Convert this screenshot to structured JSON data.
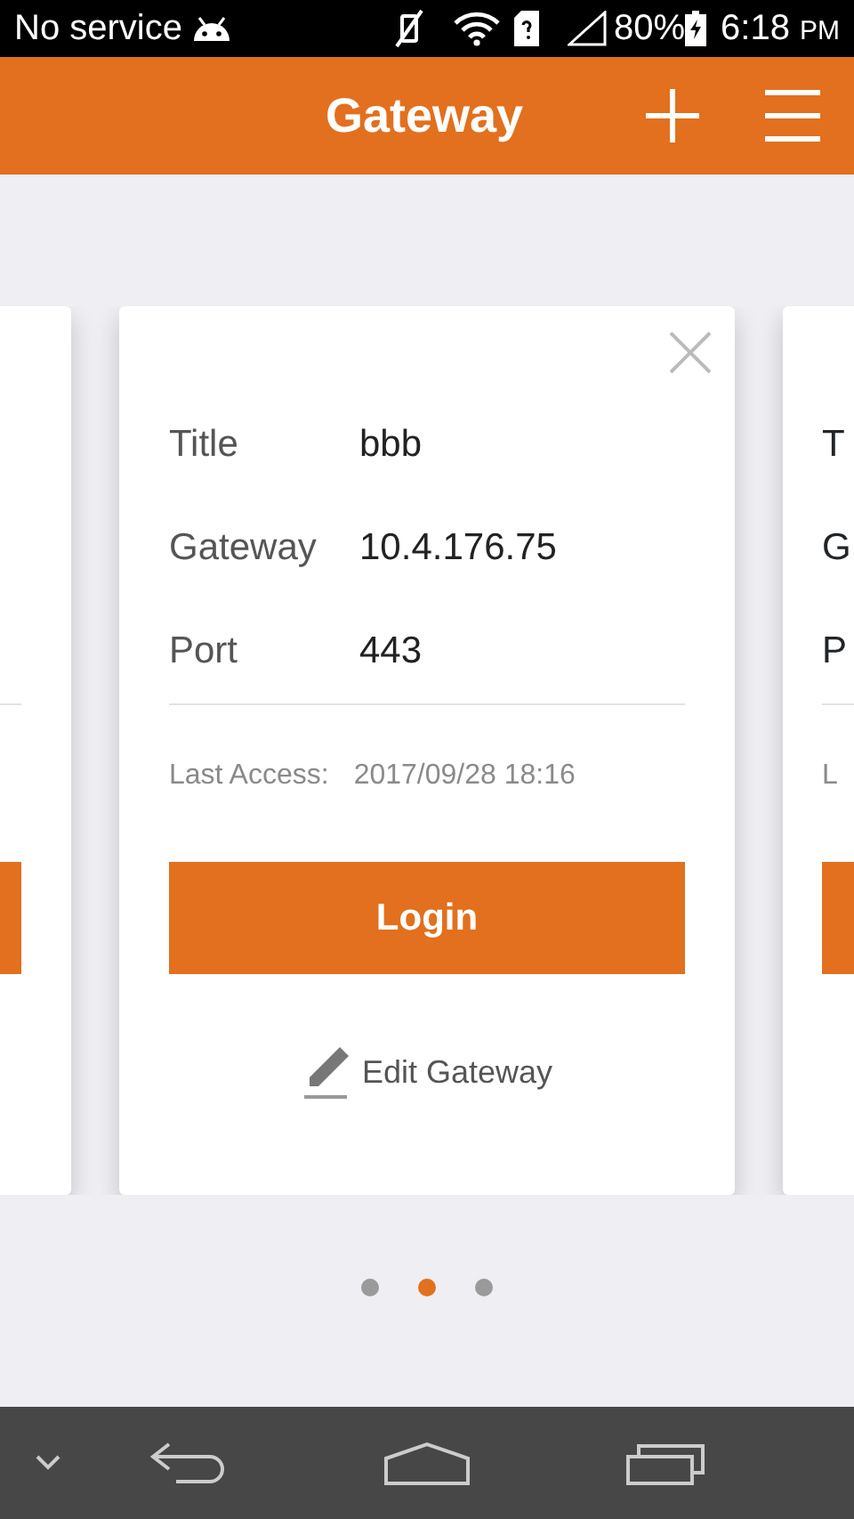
{
  "status_bar": {
    "carrier": "No service",
    "battery": "80%",
    "time": "6:18",
    "time_suffix": "PM"
  },
  "header": {
    "title": "Gateway"
  },
  "cards": [
    {
      "kind": "peek"
    },
    {
      "kind": "full",
      "fields": [
        {
          "label": "Title",
          "value": "bbb"
        },
        {
          "label": "Gateway",
          "value": "10.4.176.75"
        },
        {
          "label": "Port",
          "value": "443"
        }
      ],
      "last_access_label": "Last Access:",
      "last_access": "2017/09/28 18:16",
      "button": "Login",
      "edit": "Edit Gateway"
    },
    {
      "kind": "peek",
      "labels": [
        "T",
        "G",
        "P",
        "L"
      ]
    }
  ],
  "pager": [
    {
      "selected": false
    },
    {
      "selected": true
    },
    {
      "selected": false
    }
  ]
}
